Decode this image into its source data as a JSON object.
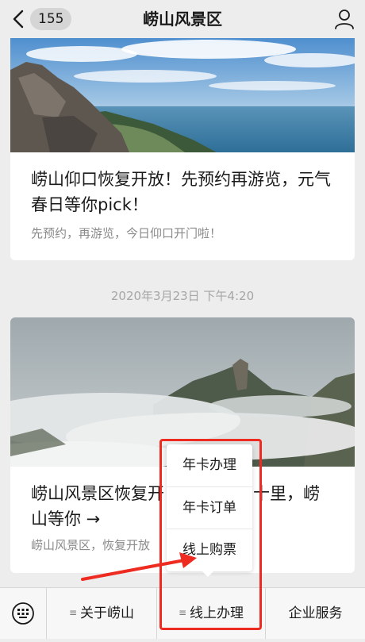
{
  "header": {
    "back_count": "155",
    "title": "崂山风景区",
    "back_icon": "chevron-left-icon",
    "profile_icon": "person-icon"
  },
  "articles": [
    {
      "title": "崂山仰口恢复开放！先预约再游览，元气春日等你pick！",
      "subtitle": "先预约，再游览，今日仰口开门啦！"
    },
    {
      "title": "崂山风景区恢复开放，三月春风十里，崂山等你 →",
      "title_visible": "崂山风景区恢复开",
      "title_visible_end": "十里，崂",
      "title_line2": "山等你 →",
      "subtitle": "崂山风景区，恢复开放"
    }
  ],
  "timestamp": "2020年3月23日 下午4:20",
  "popup_menu": {
    "items": [
      "年卡办理",
      "年卡订单",
      "线上购票"
    ]
  },
  "bottom_menu": {
    "keyboard_icon": "keyboard-icon",
    "items": [
      {
        "label": "关于崂山",
        "has_submenu": true
      },
      {
        "label": "线上办理",
        "has_submenu": true
      },
      {
        "label": "企业服务",
        "has_submenu": false
      }
    ]
  },
  "colors": {
    "background": "#ededed",
    "annotation": "#ee2b21",
    "muted_text": "#8a8a8a"
  }
}
